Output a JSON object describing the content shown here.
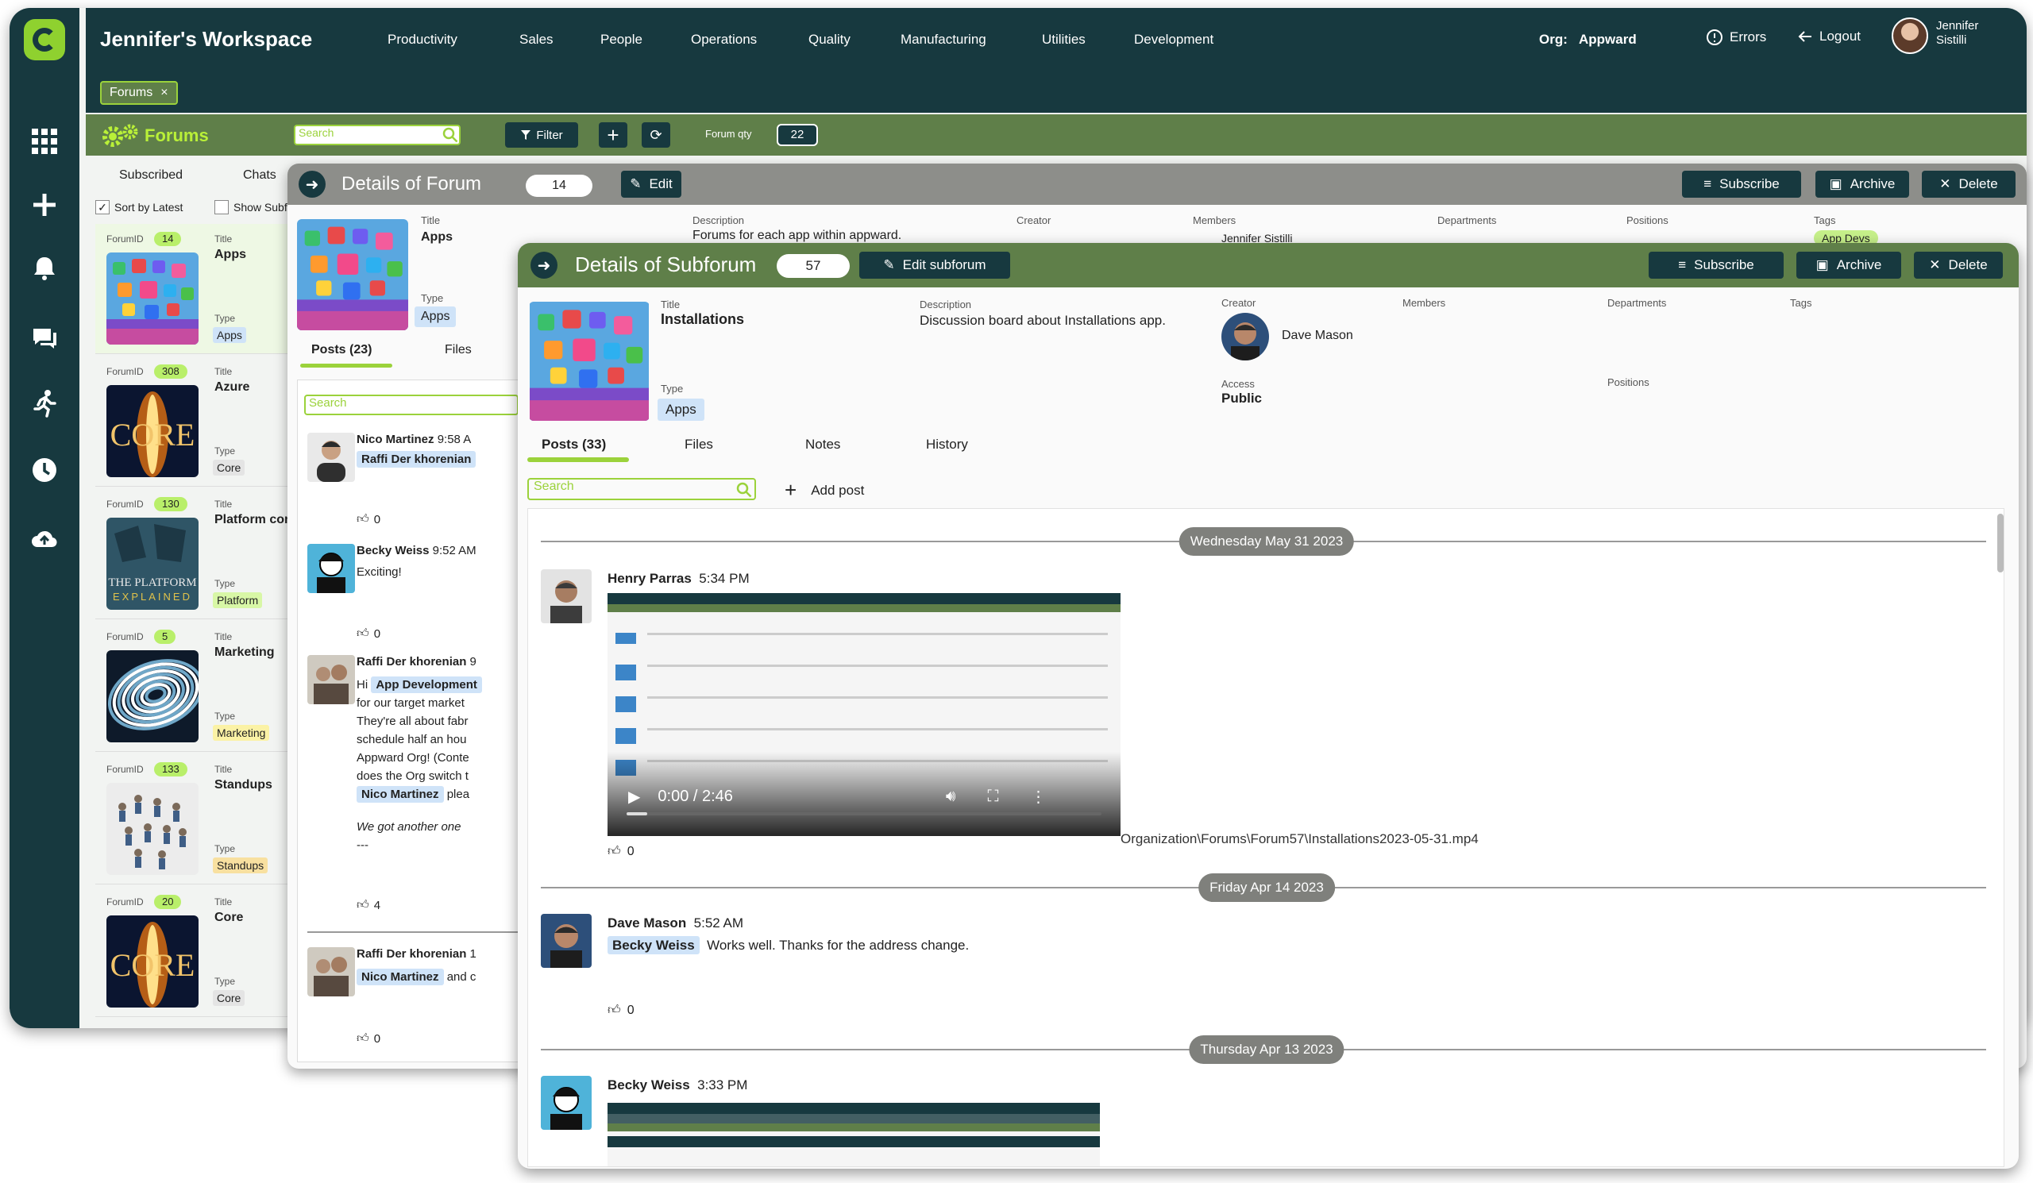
{
  "topbar": {
    "workspace_title": "Jennifer's Workspace",
    "nav": [
      "Productivity",
      "Sales",
      "People",
      "Operations",
      "Quality",
      "Manufacturing",
      "Utilities",
      "Development"
    ],
    "org_label": "Org:",
    "org_value": "Appward",
    "errors_label": "Errors",
    "logout_label": "Logout",
    "user_name": "Jennifer Sistilli"
  },
  "tabs": {
    "forums_tab": "Forums",
    "close_glyph": "×"
  },
  "forumbar": {
    "title": "Forums",
    "search_placeholder": "Search",
    "filter_label": "Filter",
    "forum_qty_label": "Forum qty",
    "forum_qty_value": "22"
  },
  "forum_list": {
    "tab_subscribed": "Subscribed",
    "tab_chats": "Chats",
    "sort_label": "Sort by Latest",
    "show_sub_label": "Show Subf",
    "id_label": "ForumID",
    "title_label": "Title",
    "type_label": "Type",
    "items": [
      {
        "id": "14",
        "title": "Apps",
        "type": "Apps",
        "type_color": "#cfe3f8"
      },
      {
        "id": "308",
        "title": "Azure",
        "type": "Core",
        "type_color": "#e4e4e4"
      },
      {
        "id": "130",
        "title": "Platform conc",
        "type": "Platform",
        "type_color": "#d8f7a6"
      },
      {
        "id": "5",
        "title": "Marketing",
        "type": "Marketing",
        "type_color": "#fbf2a5"
      },
      {
        "id": "133",
        "title": "Standups",
        "type": "Standups",
        "type_color": "#f8e0a0"
      },
      {
        "id": "20",
        "title": "Core",
        "type": "Core",
        "type_color": "#e4e4e4"
      }
    ],
    "image_text": {
      "core": "CORE",
      "platform_1": "THE PLATFORM",
      "platform_2": "EXPLAINED"
    }
  },
  "forum_detail": {
    "title": "Details of Forum",
    "count": "14",
    "edit_label": "Edit",
    "subscribe_label": "Subscribe",
    "archive_label": "Archive",
    "delete_label": "Delete",
    "title_label": "Title",
    "title_value": "Apps",
    "type_label": "Type",
    "type_value": "Apps",
    "description_label": "Description",
    "description_value": "Forums for each app within appward.",
    "creator_label": "Creator",
    "members_label": "Members",
    "members_value": "Jennifer Sistilli",
    "departments_label": "Departments",
    "positions_label": "Positions",
    "tags_label": "Tags",
    "tags_value": "App Devs",
    "tab_posts": "Posts (23)",
    "tab_files": "Files",
    "search_placeholder": "Search",
    "posts": [
      {
        "author": "Nico Martinez",
        "time": "9:58 A",
        "mention": "Raffi Der khorenian",
        "likes": "0"
      },
      {
        "author": "Becky Weiss",
        "time": "9:52 AM",
        "body": "Exciting!",
        "likes": "0"
      },
      {
        "author": "Raffi Der khorenian",
        "time": "9",
        "hi": "Hi",
        "mention": "App Development",
        "lines": [
          "for our target market",
          "They're all about fabr",
          "schedule half an hou",
          "Appward Org! (Conte",
          "does the Org switch t"
        ],
        "mention2": "Nico Martinez",
        "after_mention2": "plea",
        "italic": "We got another one",
        "dashes": "---",
        "likes": "4"
      },
      {
        "author": "Raffi Der khorenian",
        "time": "1",
        "mention": "Nico Martinez",
        "after": "and c",
        "likes": "0"
      }
    ]
  },
  "sub_detail": {
    "title": "Details of Subforum",
    "count": "57",
    "edit_label": "Edit subforum",
    "subscribe_label": "Subscribe",
    "archive_label": "Archive",
    "delete_label": "Delete",
    "title_label": "Title",
    "title_value": "Installations",
    "type_label": "Type",
    "type_value": "Apps",
    "description_label": "Description",
    "description_value": "Discussion board about Installations app.",
    "creator_label": "Creator",
    "creator_value": "Dave Mason",
    "access_label": "Access",
    "access_value": "Public",
    "members_label": "Members",
    "departments_label": "Departments",
    "positions_label": "Positions",
    "tags_label": "Tags",
    "tabs": [
      "Posts (33)",
      "Files",
      "Notes",
      "History"
    ],
    "search_placeholder": "Search",
    "add_post_label": "Add post",
    "dates": [
      "Wednesday May 31 2023",
      "Friday Apr 14 2023",
      "Thursday Apr 13 2023"
    ],
    "posts": [
      {
        "author": "Henry Parras",
        "time": "5:34 PM",
        "video_time": "0:00 / 2:46",
        "video_path": "Organization\\Forums\\Forum57\\Installations2023-05-31.mp4",
        "likes": "0"
      },
      {
        "author": "Dave Mason",
        "time": "5:52 AM",
        "mention": "Becky Weiss",
        "body": "Works well. Thanks for the address change.",
        "likes": "0"
      },
      {
        "author": "Becky Weiss",
        "time": "3:33 PM"
      }
    ]
  },
  "colors": {
    "dark_teal": "#17393f",
    "olive_green": "#5f7f49",
    "lime": "#9bd23b",
    "gray_header": "#8d8e8a"
  }
}
